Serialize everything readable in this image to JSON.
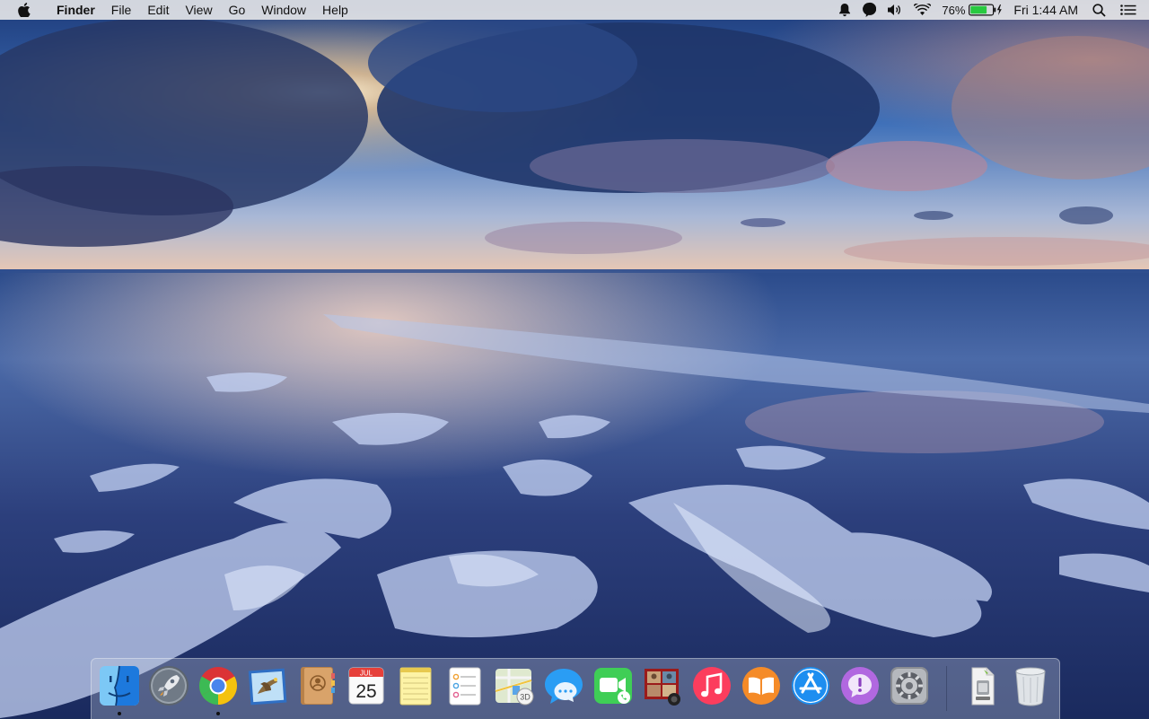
{
  "menubar": {
    "apple_icon": "apple-icon",
    "app_name": "Finder",
    "menus": [
      "File",
      "Edit",
      "View",
      "Go",
      "Window",
      "Help"
    ],
    "status": {
      "icons": [
        "notification-bell-icon",
        "messaging-icon",
        "volume-icon",
        "wifi-icon"
      ],
      "battery_percent": "76%",
      "battery_level": 0.76,
      "charging": true,
      "clock": "Fri 1:44 AM",
      "spotlight_icon": "search-icon",
      "notification_center_icon": "list-icon"
    }
  },
  "dock": {
    "apps": [
      {
        "name": "Finder",
        "icon": "finder-icon",
        "running": true
      },
      {
        "name": "Launchpad",
        "icon": "launchpad-icon",
        "running": false
      },
      {
        "name": "Google Chrome",
        "icon": "chrome-icon",
        "running": true
      },
      {
        "name": "Mail",
        "icon": "mail-icon",
        "running": false
      },
      {
        "name": "Contacts",
        "icon": "contacts-icon",
        "running": false
      },
      {
        "name": "Calendar",
        "icon": "calendar-icon",
        "running": false,
        "month": "JUL",
        "day": "25"
      },
      {
        "name": "Notes",
        "icon": "notes-icon",
        "running": false
      },
      {
        "name": "Reminders",
        "icon": "reminders-icon",
        "running": false
      },
      {
        "name": "Maps",
        "icon": "maps-icon",
        "running": false,
        "label": "3D"
      },
      {
        "name": "Messages",
        "icon": "messages-icon",
        "running": false
      },
      {
        "name": "FaceTime",
        "icon": "facetime-icon",
        "running": false
      },
      {
        "name": "Photo Booth",
        "icon": "photo-booth-icon",
        "running": false
      },
      {
        "name": "iTunes",
        "icon": "itunes-icon",
        "running": false
      },
      {
        "name": "iBooks",
        "icon": "ibooks-icon",
        "running": false
      },
      {
        "name": "App Store",
        "icon": "app-store-icon",
        "running": false
      },
      {
        "name": "Feedback Assistant",
        "icon": "feedback-icon",
        "running": false
      },
      {
        "name": "System Preferences",
        "icon": "system-preferences-icon",
        "running": false
      }
    ],
    "others": [
      {
        "name": "Downloads",
        "icon": "downloads-stack-icon"
      },
      {
        "name": "Trash",
        "icon": "trash-icon"
      }
    ]
  },
  "desktop": {
    "wallpaper": "beach-sunset-wallpaper"
  }
}
